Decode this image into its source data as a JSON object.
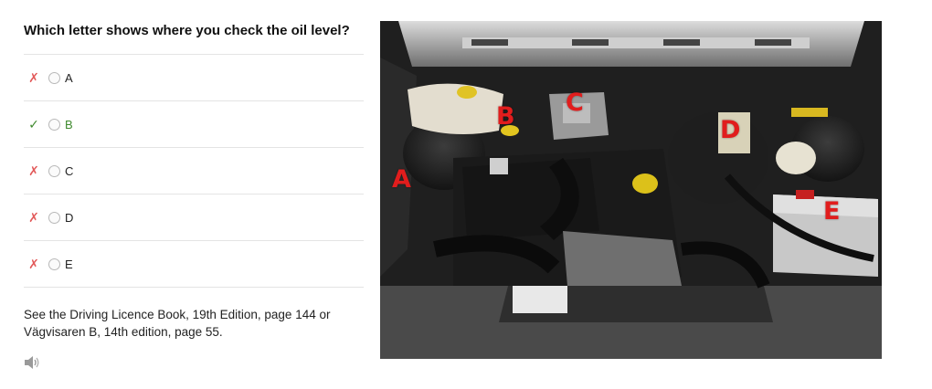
{
  "question": "Which letter shows where you check the oil level?",
  "answers": [
    {
      "label": "A",
      "status": "wrong",
      "mark": "✗"
    },
    {
      "label": "B",
      "status": "correct",
      "mark": "✓"
    },
    {
      "label": "C",
      "status": "wrong",
      "mark": "✗"
    },
    {
      "label": "D",
      "status": "wrong",
      "mark": "✗"
    },
    {
      "label": "E",
      "status": "wrong",
      "mark": "✗"
    }
  ],
  "reference": "See the Driving Licence Book, 19th Edition, page 144 or Vägvisaren B, 14th edition, page 55.",
  "image_labels": [
    "A",
    "B",
    "C",
    "D",
    "E"
  ],
  "colors": {
    "wrong": "#e25a5a",
    "correct": "#3f8a2e",
    "image_label": "#e11d1d"
  },
  "icons": {
    "audio": "speaker-icon"
  }
}
